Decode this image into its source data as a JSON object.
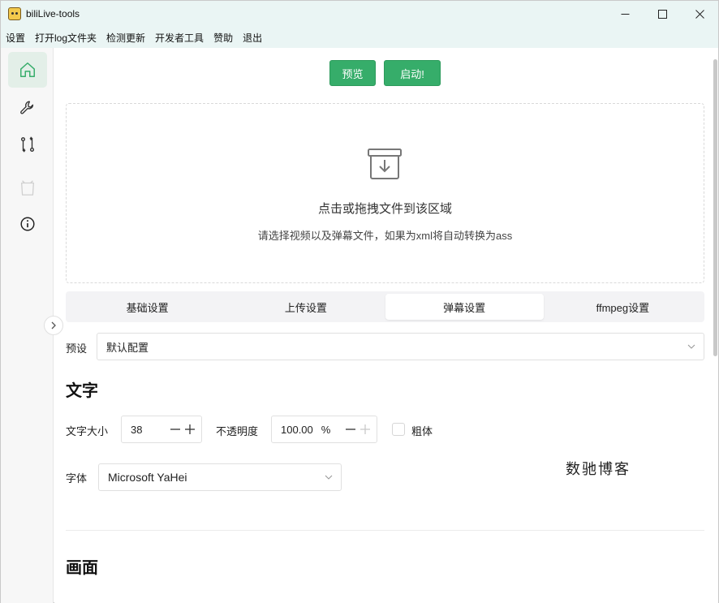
{
  "window": {
    "title": "biliLive-tools"
  },
  "menu": {
    "items": [
      "设置",
      "打开log文件夹",
      "检测更新",
      "开发者工具",
      "赞助",
      "退出"
    ]
  },
  "sidebar": {
    "items": [
      {
        "icon": "home-icon",
        "active": true
      },
      {
        "icon": "wrench-icon",
        "active": false
      },
      {
        "icon": "git-compare-icon",
        "active": false
      },
      {
        "icon": "bilibili-tv-icon",
        "active": false
      },
      {
        "icon": "info-icon",
        "active": false
      }
    ]
  },
  "actions": {
    "preview_label": "预览",
    "start_label": "启动!"
  },
  "dropzone": {
    "title": "点击或拖拽文件到该区域",
    "subtitle": "请选择视频以及弹幕文件，如果为xml将自动转换为ass"
  },
  "tabs": [
    {
      "label": "基础设置",
      "active": false
    },
    {
      "label": "上传设置",
      "active": false
    },
    {
      "label": "弹幕设置",
      "active": true
    },
    {
      "label": "ffmpeg设置",
      "active": false
    }
  ],
  "preset": {
    "label": "预设",
    "value": "默认配置"
  },
  "text_section": {
    "title": "文字",
    "font_size_label": "文字大小",
    "font_size_value": "38",
    "opacity_label": "不透明度",
    "opacity_value": "100.00",
    "opacity_unit": "%",
    "bold_label": "粗体",
    "bold_checked": false,
    "font_label": "字体",
    "font_value": "Microsoft YaHei"
  },
  "picture_section": {
    "title": "画面"
  },
  "watermark": "数驰博客",
  "colors": {
    "accent": "#36ad6a",
    "titlebar": "#eaf5f4"
  }
}
